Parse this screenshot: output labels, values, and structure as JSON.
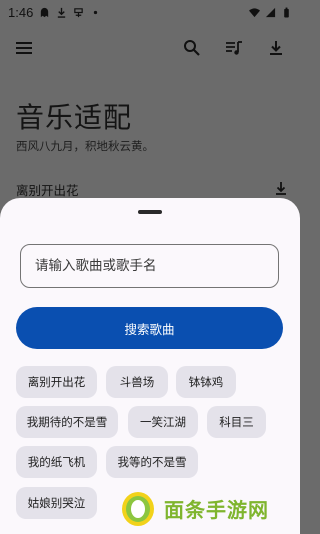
{
  "status_bar": {
    "time": "1:46",
    "icons_left": [
      "ghost-notification-icon",
      "download-notification-icon",
      "system-notification-icon",
      "dot-icon"
    ],
    "icons_right": [
      "wifi-icon",
      "signal-icon",
      "battery-icon"
    ]
  },
  "toolbar": {
    "menu_icon": "menu-icon",
    "actions": [
      "search-icon",
      "playlist-icon",
      "download-icon"
    ]
  },
  "page": {
    "title": "音乐适配",
    "subtitle": "西风八九月，积地秋云黄。",
    "first_song": "离别开出花"
  },
  "sheet": {
    "search_placeholder": "请输入歌曲或歌手名",
    "search_button": "搜索歌曲",
    "suggestions": [
      "离别开出花",
      "斗兽场",
      "钵钵鸡",
      "我期待的不是雪",
      "一笑江湖",
      "科目三",
      "我的纸飞机",
      "我等的不是雪",
      "姑娘别哭泣"
    ]
  },
  "watermark": {
    "text": "面条手游网"
  },
  "colors": {
    "accent": "#0a4fb0",
    "chip_bg": "#e4e2ea",
    "sheet_bg": "#fbf8fc",
    "scrim_bg": "#6b6b6b",
    "watermark": "#7fb52e"
  }
}
